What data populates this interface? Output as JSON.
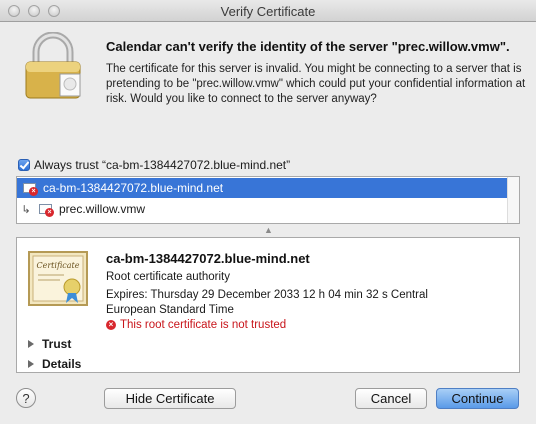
{
  "window": {
    "title": "Verify Certificate"
  },
  "dialog": {
    "headline": "Calendar can't verify the identity of the server \"prec.willow.vmw\".",
    "description": "The certificate for this server is invalid. You might be connecting to a server that is pretending to be \"prec.willow.vmw\" which could put your confidential information at risk. Would you like to connect to the server anyway?"
  },
  "trust_checkbox": {
    "label": "Always trust “ca-bm-1384427072.blue-mind.net”",
    "checked": true
  },
  "cert_tree": [
    {
      "label": "ca-bm-1384427072.blue-mind.net",
      "selected": true
    },
    {
      "label": "prec.willow.vmw",
      "selected": false
    }
  ],
  "certificate": {
    "name": "ca-bm-1384427072.blue-mind.net",
    "type": "Root certificate authority",
    "expires": "Expires: Thursday 29 December 2033 12 h 04 min 32 s Central European Standard Time",
    "warning": "This root certificate is not trusted",
    "image_text": "Certificate"
  },
  "disclosures": {
    "trust": "Trust",
    "details": "Details"
  },
  "buttons": {
    "help": "?",
    "hide_certificate": "Hide Certificate",
    "cancel": "Cancel",
    "continue": "Continue"
  },
  "colors": {
    "selection": "#3875d7",
    "warning": "#c8151b",
    "default_button": "#5a9ae8"
  }
}
